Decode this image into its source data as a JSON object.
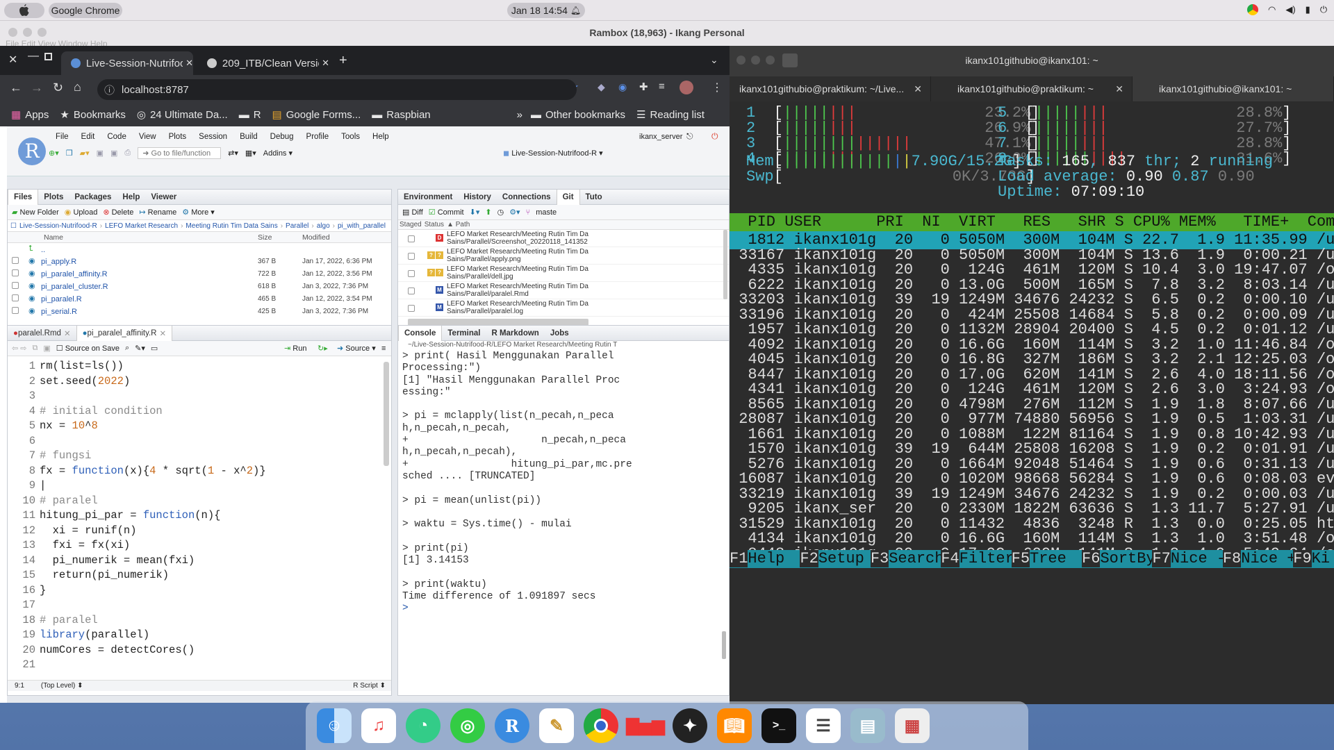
{
  "topbar": {
    "app": "Google Chrome",
    "datetime": "Jan 18  14:54"
  },
  "rambox": {
    "title": "Rambox (18,963) - Ikang Personal",
    "ghost_menu": "File  Edit  View  Window  Help"
  },
  "chrome": {
    "tabs": [
      {
        "label": "Live-Session-Nutrifood-R"
      },
      {
        "label": "209_ITB/Clean Version.Rm"
      }
    ],
    "url": "localhost:8787",
    "bookmarks": [
      "Apps",
      "Bookmarks",
      "24 Ultimate Da...",
      "R",
      "Google Forms...",
      "Raspbian"
    ],
    "other_bookmarks": "Other bookmarks",
    "reading_list": "Reading list",
    "more": "»"
  },
  "rstudio": {
    "menu": [
      "File",
      "Edit",
      "Code",
      "View",
      "Plots",
      "Session",
      "Build",
      "Debug",
      "Profile",
      "Tools",
      "Help"
    ],
    "user": "ikanx_server",
    "toolbar": {
      "goto": "Go to file/function",
      "addins": "Addins",
      "project": "Live-Session-Nutrifood-R"
    },
    "files": {
      "tabs": [
        "Files",
        "Plots",
        "Packages",
        "Help",
        "Viewer"
      ],
      "tools": [
        "New Folder",
        "Upload",
        "Delete",
        "Rename",
        "More"
      ],
      "breadcrumb": [
        "Live-Session-Nutrifood-R",
        "LEFO Market Research",
        "Meeting Rutin Tim Data Sains",
        "Parallel",
        "algo",
        "pi_with_parallel"
      ],
      "headers": [
        "Name",
        "Size",
        "Modified"
      ],
      "up": "..",
      "rows": [
        {
          "name": "pi_apply.R",
          "size": "367 B",
          "modified": "Jan 17, 2022, 6:36 PM"
        },
        {
          "name": "pi_paralel_affinity.R",
          "size": "722 B",
          "modified": "Jan 12, 2022, 3:56 PM"
        },
        {
          "name": "pi_paralel_cluster.R",
          "size": "618 B",
          "modified": "Jan 3, 2022, 7:36 PM"
        },
        {
          "name": "pi_paralel.R",
          "size": "465 B",
          "modified": "Jan 12, 2022, 3:54 PM"
        },
        {
          "name": "pi_serial.R",
          "size": "425 B",
          "modified": "Jan 3, 2022, 7:36 PM"
        }
      ]
    },
    "git": {
      "tabs": [
        "Environment",
        "History",
        "Connections",
        "Git",
        "Tuto"
      ],
      "tools": [
        "Diff",
        "Commit",
        "maste"
      ],
      "headers": [
        "Staged",
        "Status",
        "Path"
      ],
      "rows": [
        {
          "l1": "LEFO Market Research/Meeting Rutin Tim Da",
          "l2": "Sains/Parallel/Screenshot_20220118_141352",
          "status": "D"
        },
        {
          "l1": "LEFO Market Research/Meeting Rutin Tim Da",
          "l2": "Sains/Parallel/apply.png",
          "status": "??"
        },
        {
          "l1": "LEFO Market Research/Meeting Rutin Tim Da",
          "l2": "Sains/Parallel/dell.jpg",
          "status": "??"
        },
        {
          "l1": "LEFO Market Research/Meeting Rutin Tim Da",
          "l2": "Sains/Parallel/paralel.Rmd",
          "status": "M"
        },
        {
          "l1": "LEFO Market Research/Meeting Rutin Tim Da",
          "l2": "Sains/Parallel/paralel.log",
          "status": "M"
        }
      ]
    },
    "editor": {
      "tabs": [
        "paralel.Rmd",
        "pi_paralel_affinity.R"
      ],
      "source_on_save": "Source on Save",
      "run": "Run",
      "source": "Source",
      "status_pos": "9:1",
      "status_level": "(Top Level)",
      "status_type": "R Script"
    },
    "console": {
      "tabs": [
        "Console",
        "Terminal",
        "R Markdown",
        "Jobs"
      ],
      "path": "~/Live-Session-Nutrifood-R/LEFO Market Research/Meeting Rutin T",
      "lines": [
        "> print( Hasil Menggunakan Parallel",
        "Processing:\")",
        "[1] \"Hasil Menggunakan Parallel Proc",
        "essing:\"",
        "",
        "> pi = mclapply(list(n_pecah,n_peca",
        "h,n_pecah,n_pecah,",
        "+                      n_pecah,n_peca",
        "h,n_pecah,n_pecah),",
        "+                 hitung_pi_par,mc.pre",
        "sched .... [TRUNCATED]",
        "",
        "> pi = mean(unlist(pi))",
        "",
        "> waktu = Sys.time() - mulai",
        "",
        "> print(pi)",
        "[1] 3.14153",
        "",
        "> print(waktu)",
        "Time difference of 1.091897 secs",
        ">"
      ]
    }
  },
  "terminal": {
    "title": "ikanx101githubio@ikanx101: ~",
    "tabs": [
      "ikanx101githubio@praktikum: ~/Live...",
      "ikanx101githubio@praktikum: ~",
      "ikanx101githubio@ikanx101: ~"
    ],
    "cpus": [
      {
        "n": "1",
        "pct": "23.2%"
      },
      {
        "n": "2",
        "pct": "26.9%"
      },
      {
        "n": "3",
        "pct": "47.1%"
      },
      {
        "n": "4",
        "pct": "26.0%"
      },
      {
        "n": "5",
        "pct": "28.8%"
      },
      {
        "n": "6",
        "pct": "27.7%"
      },
      {
        "n": "7",
        "pct": "28.8%"
      },
      {
        "n": "8",
        "pct": "31.6%"
      }
    ],
    "mem": "7.90G/15.2G",
    "swp": "0K/3.73G",
    "tasks": "165",
    "thr": "837",
    "running": "2",
    "load": [
      "0.90",
      "0.87",
      "0.90"
    ],
    "uptime": "07:09:10",
    "header": "  PID USER      PRI  NI  VIRT   RES   SHR S CPU% MEM%   TIME+  Com",
    "procs": [
      "  1812 ikanx101g  20   0 5050M  300M  104M S 22.7  1.9 11:35.99 /us",
      " 33167 ikanx101g  20   0 5050M  300M  104M S 13.6  1.9  0:00.21 /us",
      "  4335 ikanx101g  20   0  124G  461M  120M S 10.4  3.0 19:47.07 /op",
      "  6222 ikanx101g  20   0 13.0G  500M  165M S  7.8  3.2  8:03.14 /us",
      " 33203 ikanx101g  39  19 1249M 34676 24232 S  6.5  0.2  0:00.10 /us",
      " 33196 ikanx101g  20   0  424M 25508 14684 S  5.8  0.2  0:00.09 /us",
      "  1957 ikanx101g  20   0 1132M 28904 20400 S  4.5  0.2  0:01.12 /us",
      "  4092 ikanx101g  20   0 16.6G  160M  114M S  3.2  1.0 11:46.84 /op",
      "  4045 ikanx101g  20   0 16.8G  327M  186M S  3.2  2.1 12:25.03 /op",
      "  8447 ikanx101g  20   0 17.0G  620M  141M S  2.6  4.0 18:11.56 /op",
      "  4341 ikanx101g  20   0  124G  461M  120M S  2.6  3.0  3:24.93 /op",
      "  8565 ikanx101g  20   0 4798M  276M  112M S  1.9  1.8  8:07.66 /us",
      " 28087 ikanx101g  20   0  977M 74880 56956 S  1.9  0.5  1:03.31 /us",
      "  1661 ikanx101g  20   0 1088M  122M 81164 S  1.9  0.8 10:42.93 /us",
      "  1570 ikanx101g  39  19  644M 25808 16208 S  1.9  0.2  0:01.91 /us",
      "  5276 ikanx101g  20   0 1664M 92048 51464 S  1.9  0.6  0:31.13 /us",
      " 16087 ikanx101g  20   0 1020M 98668 56284 S  1.9  0.6  0:08.03 evi",
      " 33219 ikanx101g  39  19 1249M 34676 24232 S  1.9  0.2  0:00.03 /us",
      "  9205 ikanx_ser  20   0 2330M 1822M 63636 S  1.3 11.7  5:27.91 /us",
      " 31529 ikanx101g  20   0 11432  4836  3248 R  1.3  0.0  0:25.05 hto",
      "  4134 ikanx101g  20   0 16.6G  160M  114M S  1.3  1.0  3:51.48 /op",
      "  8448 ikanx101g  20   0 17.0G  620M  141M S  1.3  4.0  5:49.24 /op"
    ],
    "fkeys": [
      [
        "F1",
        "Help"
      ],
      [
        "F2",
        "Setup"
      ],
      [
        "F3",
        "Search"
      ],
      [
        "F4",
        "Filter"
      ],
      [
        "F5",
        "Tree"
      ],
      [
        "F6",
        "SortBy"
      ],
      [
        "F7",
        "Nice -"
      ],
      [
        "F8",
        "Nice +"
      ],
      [
        "F9",
        "Ki"
      ]
    ]
  },
  "dock": {
    "items": [
      "finder-icon",
      "music-icon",
      "app-icon",
      "app-icon-2",
      "r-icon",
      "notes-icon",
      "chrome-icon",
      "chart-icon",
      "inkscape-icon",
      "books-icon",
      "terminal-icon",
      "list-icon",
      "preview-icon",
      "launchpad-icon"
    ]
  }
}
